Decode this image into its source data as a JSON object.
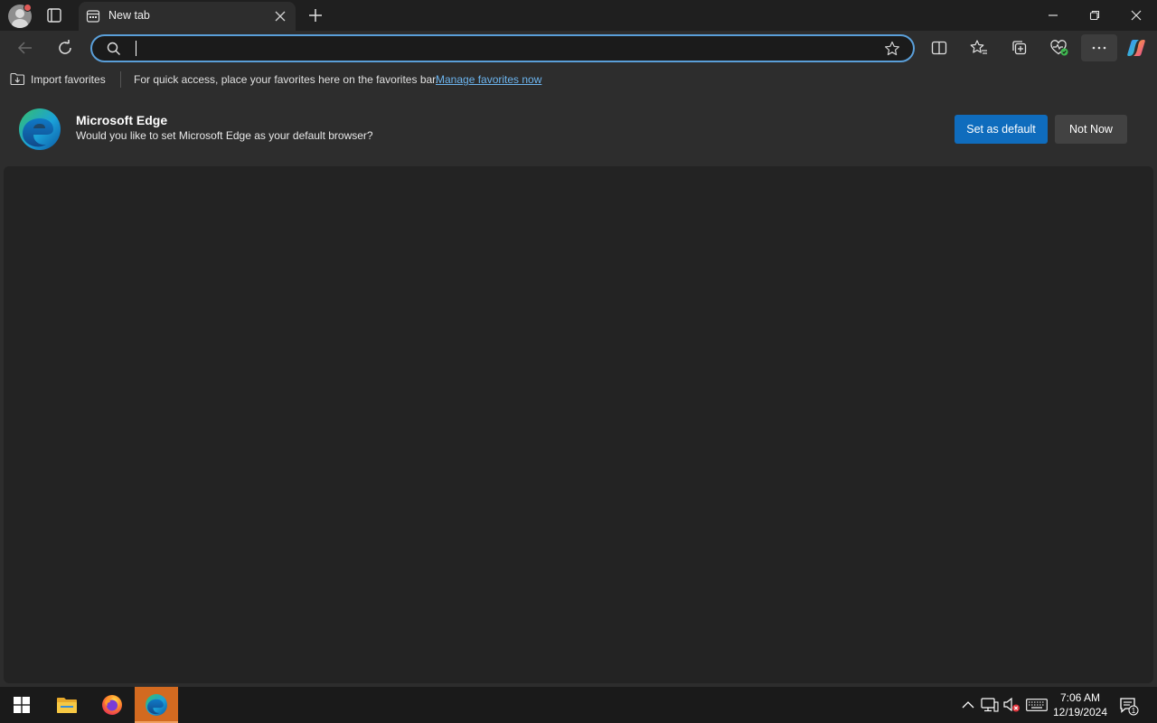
{
  "tab": {
    "title": "New tab"
  },
  "omnibox": {
    "value": "",
    "placeholder": ""
  },
  "favorites_bar": {
    "import_label": "Import favorites",
    "hint": "For quick access, place your favorites here on the favorites bar.",
    "manage_link": "Manage favorites now"
  },
  "banner": {
    "title": "Microsoft Edge",
    "message": "Would you like to set Microsoft Edge as your default browser?",
    "primary_button": "Set as default",
    "secondary_button": "Not Now"
  },
  "taskbar": {
    "time": "7:06 AM",
    "date": "12/19/2024",
    "notification_count": "1"
  },
  "icons": {
    "profile": "profile-avatar-icon",
    "tab_actions": "tab-actions-icon",
    "back": "back-arrow-icon",
    "refresh": "refresh-icon",
    "search": "search-icon",
    "favorite_star": "star-icon",
    "split_screen": "split-screen-icon",
    "favorites": "favorites-icon",
    "collections": "collections-icon",
    "browser_essentials": "browser-essentials-icon",
    "more": "more-icon",
    "copilot": "copilot-icon"
  },
  "colors": {
    "accent": "#0f6cbd",
    "omnibox_border": "#5a9fd9",
    "link": "#6cb4ee",
    "active_taskbar": "#d36a20"
  }
}
